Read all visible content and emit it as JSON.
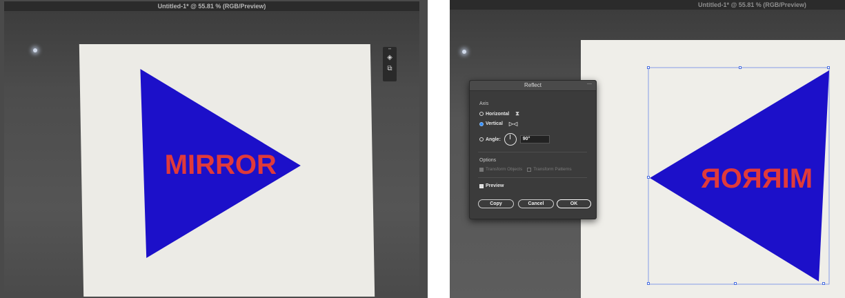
{
  "window": {
    "title_left": "Untitled-1* @ 55.81 % (RGB/Preview)",
    "title_right": "Untitled-1* @ 55.81 % (RGB/Preview)"
  },
  "artwork": {
    "text": "MIRROR",
    "triangle_color": "#1c10c9",
    "text_color": "#e03a3a"
  },
  "reflect_dialog": {
    "title": "Reflect",
    "axis_label": "Axis",
    "horizontal_label": "Horizontal",
    "vertical_label": "Vertical",
    "angle_label": "Angle:",
    "angle_value": "90°",
    "selected_axis": "Vertical",
    "options_label": "Options",
    "transform_objects_label": "Transform Objects",
    "transform_patterns_label": "Transform Patterns",
    "preview_label": "Preview",
    "copy_label": "Copy",
    "cancel_label": "Cancel",
    "ok_label": "OK"
  },
  "icons": {
    "horizontal_axis": "hourglass-reflect-icon",
    "vertical_axis": "reflect-vertical-icon",
    "angle": "angle-dial-icon",
    "panel_layers": "layers-icon",
    "panel_libraries": "libraries-icon"
  }
}
